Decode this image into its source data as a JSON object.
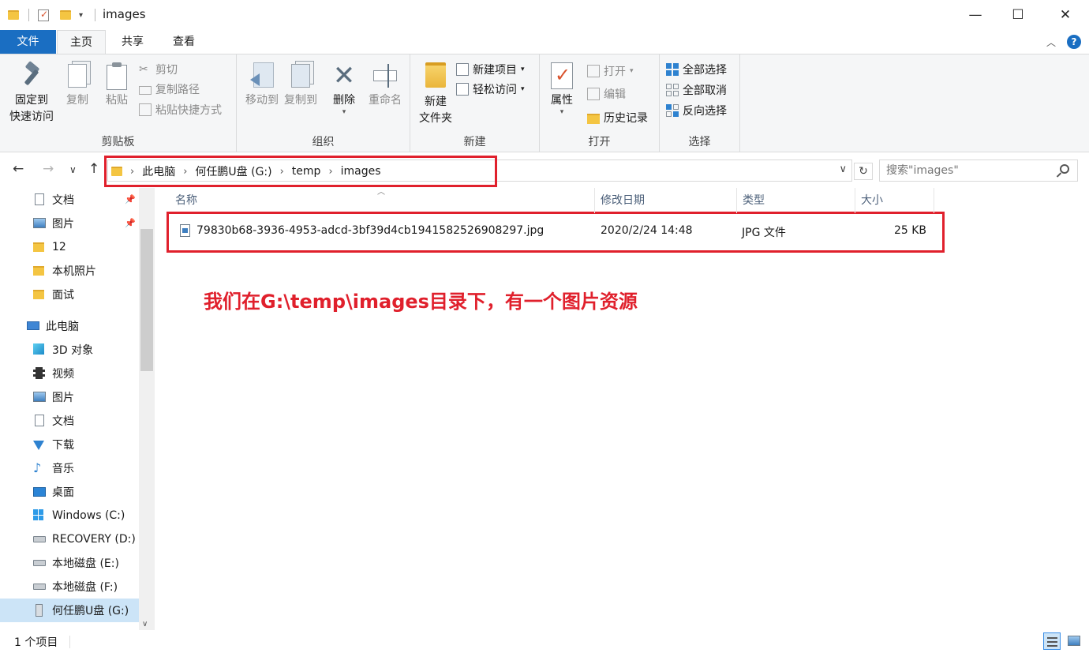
{
  "window": {
    "title": "images",
    "minimize": "—",
    "maximize": "☐",
    "close": "✕"
  },
  "ribbon_tabs": {
    "file": "文件",
    "home": "主页",
    "share": "共享",
    "view": "查看"
  },
  "ribbon": {
    "clipboard": {
      "label": "剪贴板",
      "pin": [
        "固定到",
        "快速访问"
      ],
      "copy": "复制",
      "paste": "粘贴",
      "cut": "剪切",
      "copy_path": "复制路径",
      "paste_shortcut": "粘贴快捷方式"
    },
    "organize": {
      "label": "组织",
      "move_to": "移动到",
      "copy_to": "复制到",
      "delete": "删除",
      "rename": "重命名"
    },
    "new": {
      "label": "新建",
      "new_folder": [
        "新建",
        "文件夹"
      ],
      "new_item": "新建项目",
      "easy_access": "轻松访问"
    },
    "open": {
      "label": "打开",
      "properties": "属性",
      "open": "打开",
      "edit": "编辑",
      "history": "历史记录"
    },
    "select": {
      "label": "选择",
      "select_all": "全部选择",
      "select_none": "全部取消",
      "invert": "反向选择"
    }
  },
  "address": {
    "crumbs": [
      "此电脑",
      "何任鹏U盘 (G:)",
      "temp",
      "images"
    ],
    "search_placeholder": "搜索\"images\""
  },
  "nav_pane": {
    "quick_access": [
      {
        "label": "文档",
        "icon": "document-icon",
        "pinned": true
      },
      {
        "label": "图片",
        "icon": "picture-icon",
        "pinned": true
      },
      {
        "label": "12",
        "icon": "folder-icon"
      },
      {
        "label": "本机照片",
        "icon": "folder-icon"
      },
      {
        "label": "面试",
        "icon": "folder-icon"
      }
    ],
    "this_pc": "此电脑",
    "pc_items": [
      {
        "label": "3D 对象",
        "icon": "3d-objects-icon"
      },
      {
        "label": "视频",
        "icon": "video-icon"
      },
      {
        "label": "图片",
        "icon": "picture-icon"
      },
      {
        "label": "文档",
        "icon": "document-icon"
      },
      {
        "label": "下载",
        "icon": "download-icon"
      },
      {
        "label": "音乐",
        "icon": "music-icon"
      },
      {
        "label": "桌面",
        "icon": "desktop-icon"
      },
      {
        "label": "Windows (C:)",
        "icon": "windows-drive-icon"
      },
      {
        "label": "RECOVERY (D:)",
        "icon": "drive-icon"
      },
      {
        "label": "本地磁盘 (E:)",
        "icon": "drive-icon"
      },
      {
        "label": "本地磁盘 (F:)",
        "icon": "drive-icon"
      },
      {
        "label": "何任鹏U盘 (G:)",
        "icon": "usb-drive-icon",
        "selected": true
      }
    ]
  },
  "columns": {
    "name": "名称",
    "date": "修改日期",
    "type": "类型",
    "size": "大小"
  },
  "files": [
    {
      "name": "79830b68-3936-4953-adcd-3bf39d4cb1941582526908297.jpg",
      "date": "2020/2/24 14:48",
      "type": "JPG 文件",
      "size": "25 KB"
    }
  ],
  "annotation": "我们在G:\\temp\\images目录下，有一个图片资源",
  "status": {
    "count": "1 个项目"
  },
  "colors": {
    "accent": "#1a6ec2",
    "highlight": "#e0202c",
    "selected_bg": "#cce4f7"
  }
}
